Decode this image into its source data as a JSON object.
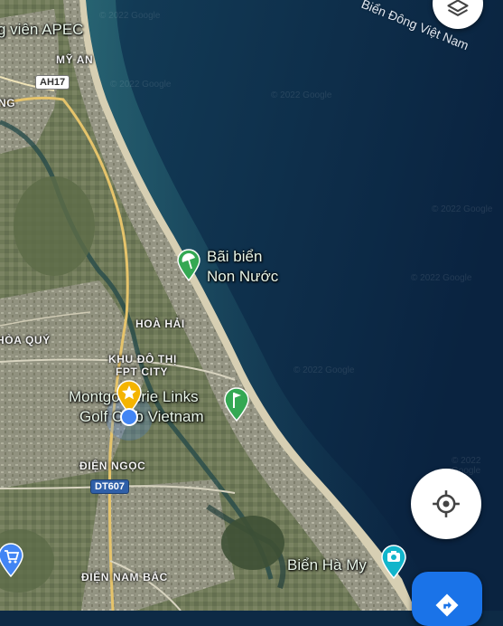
{
  "map": {
    "water_name": "Biển Đông Việt Nam",
    "watermark": "© 2022 Google",
    "places": [
      {
        "name": "Bãi biển",
        "name2": "Non Nước",
        "type": "beach",
        "icon": "beach-umbrella-icon"
      },
      {
        "name": "Montgomerie Links",
        "name2": "Golf Club Vietnam",
        "type": "golf-course",
        "icon": "golf-flag-icon"
      },
      {
        "name": "Biển Hà My",
        "type": "tourist-attraction",
        "icon": "camera-icon"
      },
      {
        "name": "g viên APEC",
        "type": "park"
      }
    ],
    "areas": [
      "MỸ AN",
      "HOÀ HẢI",
      "HÒA QUÝ",
      "KHU ĐÔ THỊ",
      "FPT CITY",
      "ĐIỆN NGỌC",
      "ĐIỆN NAM BẮC",
      "NG"
    ],
    "roads": [
      "AH17",
      "DT607"
    ]
  },
  "controls": {
    "layers_icon": "layers-icon",
    "my_location_icon": "my-location-icon",
    "directions_icon": "directions-icon"
  },
  "colors": {
    "sea_deep": "#0c2741",
    "sea_shallow": "#1f5a6b",
    "land": "#7d8566",
    "urban": "#a8a79c",
    "beach_sand": "#d9d2b8",
    "beach_pin": "#34a853",
    "star_pin": "#f4b400",
    "location_dot": "#4285f4",
    "directions_fab": "#1a73e8"
  }
}
